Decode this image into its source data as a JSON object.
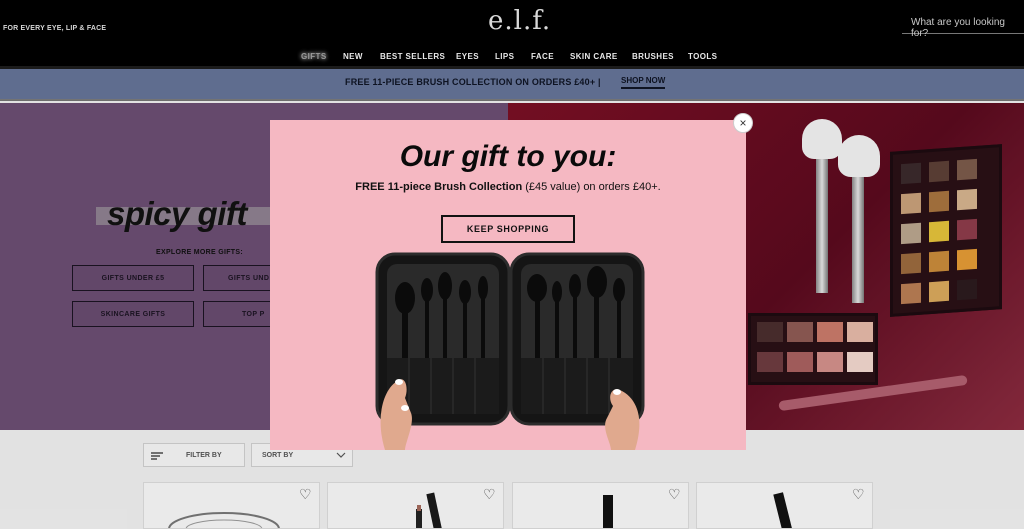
{
  "header": {
    "tagline": "FOR EVERY EYE, LIP & FACE",
    "logo": "e.l.f.",
    "search_placeholder": "What are you looking for?"
  },
  "nav": {
    "items": [
      {
        "label": "GIFTS",
        "active": true
      },
      {
        "label": "NEW"
      },
      {
        "label": "BEST SELLERS"
      },
      {
        "label": "EYES"
      },
      {
        "label": "LIPS"
      },
      {
        "label": "FACE"
      },
      {
        "label": "SKIN CARE"
      },
      {
        "label": "BRUSHES"
      },
      {
        "label": "TOOLS"
      }
    ]
  },
  "promo": {
    "text": "FREE 11-PIECE BRUSH COLLECTION ON ORDERS £40+ |",
    "link": "SHOP NOW"
  },
  "hero": {
    "title": "spicy gift",
    "explore": "EXPLORE MORE GIFTS:",
    "buttons": [
      "GIFTS UNDER £5",
      "GIFTS UND",
      "SKINCARE GIFTS",
      "TOP P"
    ]
  },
  "filters": {
    "filter_label": "FILTER BY",
    "sort_label": "SORT BY"
  },
  "modal": {
    "title": "Our gift to you:",
    "subtitle_bold": "FREE 11-piece Brush Collection",
    "subtitle_rest": " (£45 value) on orders £40+.",
    "button": "KEEP SHOPPING",
    "close": "×"
  },
  "colors": {
    "header_bg": "#000000",
    "promo_bg": "#5f6d8f",
    "hero_left": "#6b4d72",
    "modal_bg": "#f5b8c2"
  }
}
